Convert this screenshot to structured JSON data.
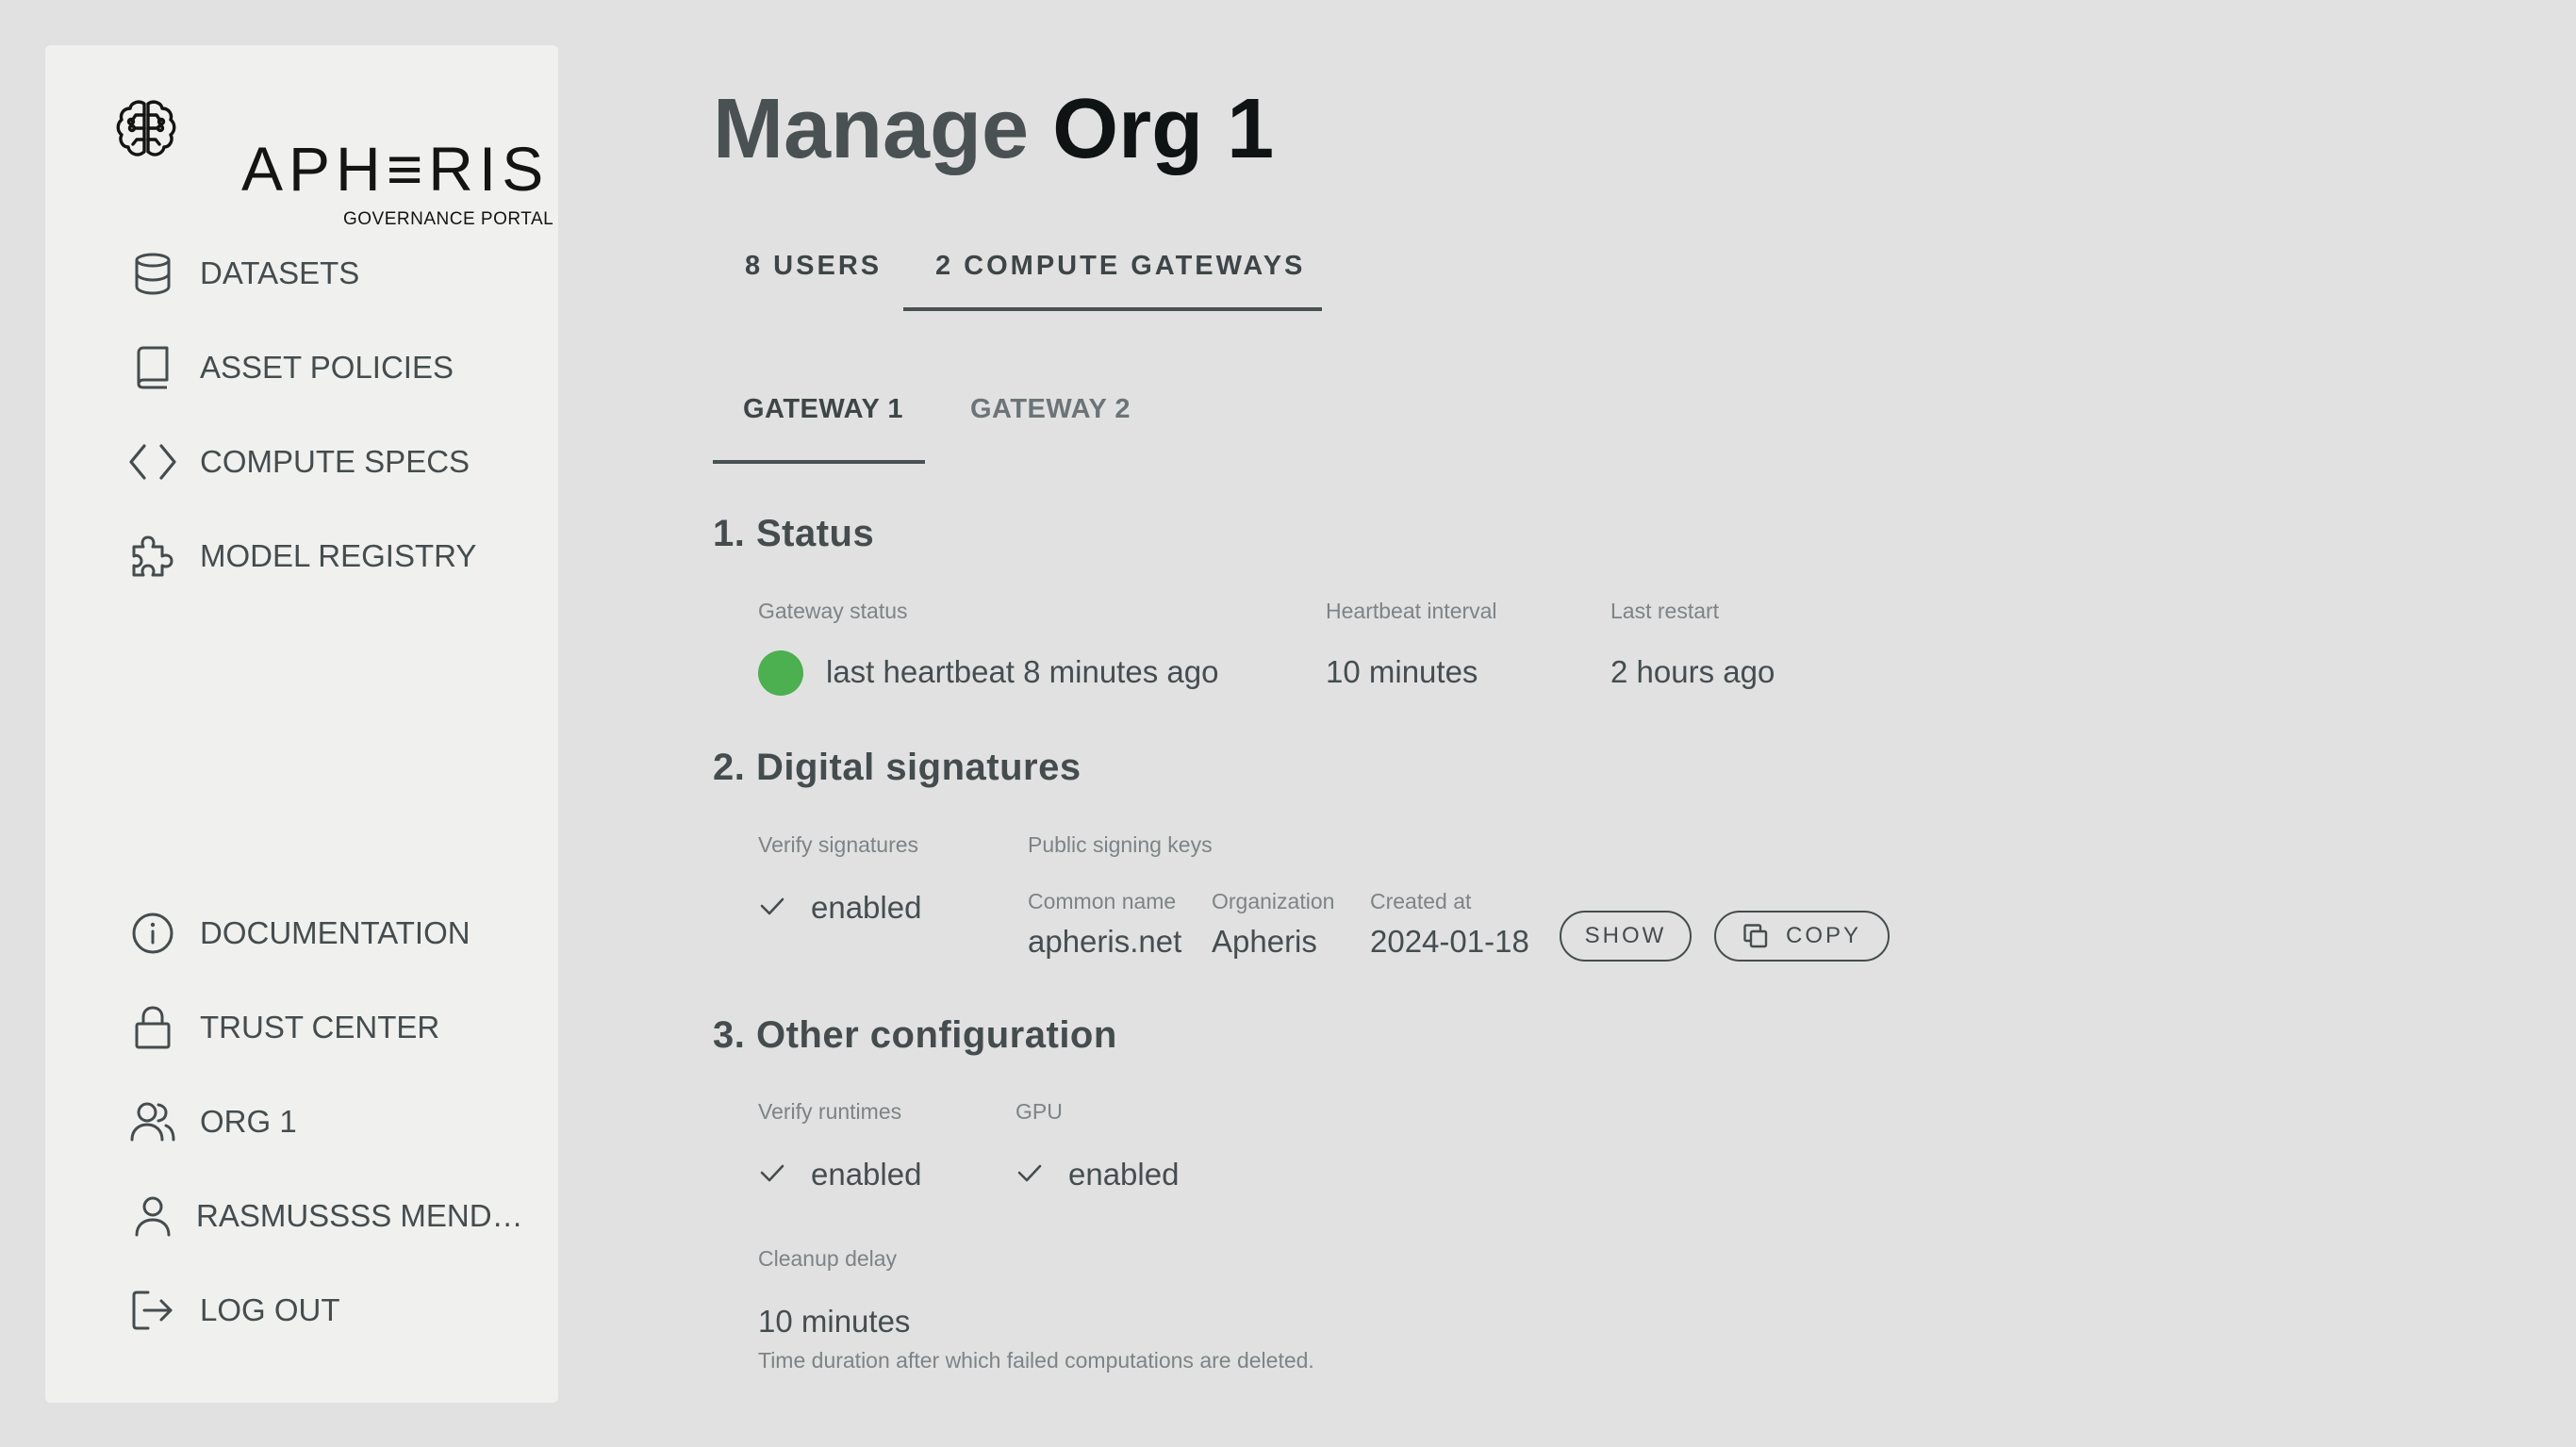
{
  "brand": {
    "name": "APH≡RIS",
    "subtitle": "GOVERNANCE PORTAL"
  },
  "sidebar": {
    "top_items": [
      {
        "label": "DATASETS",
        "icon": "database-icon"
      },
      {
        "label": "ASSET POLICIES",
        "icon": "book-icon"
      },
      {
        "label": "COMPUTE SPECS",
        "icon": "code-icon"
      },
      {
        "label": "MODEL REGISTRY",
        "icon": "puzzle-icon"
      }
    ],
    "bottom_items": [
      {
        "label": "DOCUMENTATION",
        "icon": "info-icon"
      },
      {
        "label": "TRUST CENTER",
        "icon": "lock-icon"
      },
      {
        "label": "ORG 1",
        "icon": "users-icon"
      },
      {
        "label": "RASMUSSSS MENDO...",
        "icon": "user-icon"
      },
      {
        "label": "LOG OUT",
        "icon": "logout-icon"
      }
    ]
  },
  "page": {
    "title_prefix": "Manage",
    "title_org": "Org 1"
  },
  "tabs": [
    {
      "label": "8 USERS",
      "active": false
    },
    {
      "label": "2 COMPUTE GATEWAYS",
      "active": true
    }
  ],
  "gateway_tabs": [
    {
      "label": "GATEWAY 1",
      "active": true
    },
    {
      "label": "GATEWAY 2",
      "active": false
    }
  ],
  "status": {
    "heading": "1. Status",
    "gateway_status_label": "Gateway status",
    "gateway_status_value": "last heartbeat 8 minutes ago",
    "status_color": "#4caf50",
    "heartbeat_label": "Heartbeat interval",
    "heartbeat_value": "10 minutes",
    "restart_label": "Last restart",
    "restart_value": "2 hours ago"
  },
  "signatures": {
    "heading": "2. Digital signatures",
    "verify_label": "Verify signatures",
    "verify_value": "enabled",
    "keys_label": "Public signing keys",
    "columns": {
      "common_name": "Common name",
      "organization": "Organization",
      "created_at": "Created at"
    },
    "key": {
      "common_name": "apheris.net",
      "organization": "Apheris",
      "created_at": "2024-01-18"
    },
    "show_label": "SHOW",
    "copy_label": "COPY"
  },
  "other": {
    "heading": "3. Other configuration",
    "verify_runtimes_label": "Verify runtimes",
    "verify_runtimes_value": "enabled",
    "gpu_label": "GPU",
    "gpu_value": "enabled",
    "cleanup_label": "Cleanup delay",
    "cleanup_value": "10 minutes",
    "cleanup_helper": "Time duration after which failed computations are deleted."
  }
}
